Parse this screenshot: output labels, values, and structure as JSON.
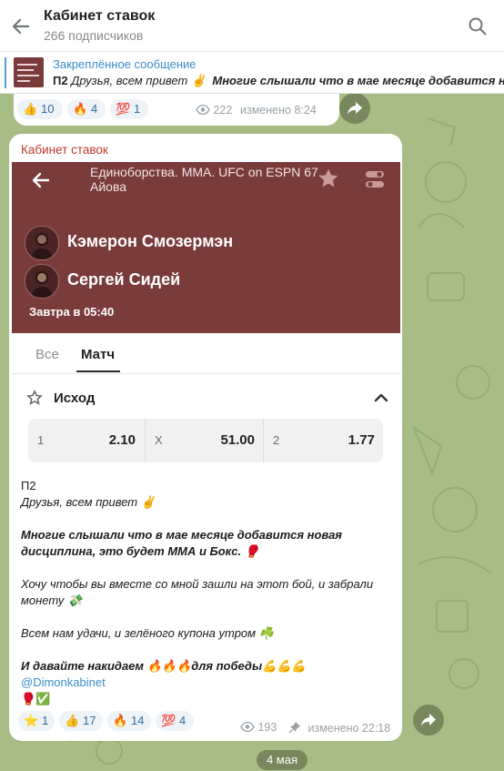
{
  "header": {
    "title": "Кабинет ставок",
    "subtitle": "266 подписчиков"
  },
  "pinned": {
    "title": "Закреплённое сообщение",
    "prefix": "П2",
    "text": "Друзья, всем привет ✌️",
    "bold_text": "Многие слышали что в мае месяце добавится нов"
  },
  "prev_message": {
    "reactions": [
      {
        "emoji": "👍",
        "count": "10"
      },
      {
        "emoji": "🔥",
        "count": "4"
      },
      {
        "emoji": "💯",
        "count": "1"
      }
    ],
    "views": "222",
    "edited": "изменено 8:24"
  },
  "message": {
    "author": "Кабинет ставок",
    "event": {
      "title": "Единоборства. MMA. UFC on ESPN 67. Айова",
      "fighter1": "Кэмерон Смозермэн",
      "fighter2": "Сергей Сидей",
      "time": "Завтра в 05:40",
      "tabs": [
        "Все",
        "Матч"
      ],
      "outcome_title": "Исход",
      "odds": [
        {
          "label": "1",
          "value": "2.10"
        },
        {
          "label": "X",
          "value": "51.00"
        },
        {
          "label": "2",
          "value": "1.77"
        }
      ]
    },
    "caption": {
      "line1": "П2",
      "line2": "Друзья, всем привет ✌️",
      "line3": "Многие слышали что в мае месяце добавится новая",
      "line4": "дисциплина, это будет ММА и Бокс. 🥊",
      "line5": "Хочу чтобы вы вместе со мной зашли на этот бой, и забрали",
      "line6": "монету 💸",
      "line7": "Всем нам удачи, и зелёного купона утром ☘️",
      "line8": "И давайте накидаем 🔥🔥🔥для  победы💪💪💪",
      "mention": "@Dimonkabinet",
      "line10": "🥊✅"
    },
    "reactions": [
      {
        "emoji": "⭐",
        "count": "1"
      },
      {
        "emoji": "👍",
        "count": "17"
      },
      {
        "emoji": "🔥",
        "count": "14"
      },
      {
        "emoji": "💯",
        "count": "4"
      }
    ],
    "views": "193",
    "edited": "изменено 22:18"
  },
  "date_separator": "4 мая",
  "colors": {
    "accent": "#3a8dc7",
    "event_bg": "#7a3b3b",
    "author": "#c0392b",
    "chat_bg": "#a9bf86"
  }
}
